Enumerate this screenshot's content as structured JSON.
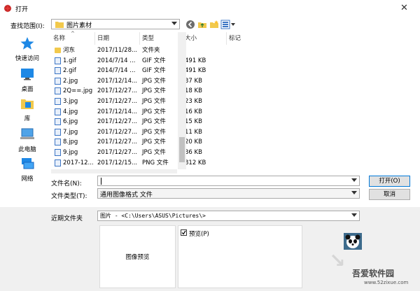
{
  "window": {
    "title": "打开"
  },
  "lookin": {
    "label": "查找范围(I):",
    "value": "图片素材"
  },
  "sidebar": {
    "items": [
      {
        "label": "快速访问",
        "icon": "star-icon"
      },
      {
        "label": "桌面",
        "icon": "desktop-icon"
      },
      {
        "label": "库",
        "icon": "library-icon"
      },
      {
        "label": "此电脑",
        "icon": "computer-icon"
      },
      {
        "label": "网络",
        "icon": "network-icon"
      }
    ]
  },
  "columns": [
    "名称",
    "日期",
    "类型",
    "大小",
    "标记"
  ],
  "files": [
    {
      "name": "河东",
      "date": "2017/11/28...",
      "type": "文件夹",
      "size": "",
      "icon": "folder-icon"
    },
    {
      "name": "1.gif",
      "date": "2014/7/14 ...",
      "type": "GIF 文件",
      "size": "491 KB",
      "icon": "file-icon"
    },
    {
      "name": "2.gif",
      "date": "2014/7/14 ...",
      "type": "GIF 文件",
      "size": "491 KB",
      "icon": "file-icon"
    },
    {
      "name": "2.jpg",
      "date": "2017/12/14...",
      "type": "JPG 文件",
      "size": "37 KB",
      "icon": "file-icon"
    },
    {
      "name": "2Q==.jpg",
      "date": "2017/12/27...",
      "type": "JPG 文件",
      "size": "18 KB",
      "icon": "file-icon"
    },
    {
      "name": "3.jpg",
      "date": "2017/12/27...",
      "type": "JPG 文件",
      "size": "23 KB",
      "icon": "file-icon"
    },
    {
      "name": "4.jpg",
      "date": "2017/12/14...",
      "type": "JPG 文件",
      "size": "16 KB",
      "icon": "file-icon"
    },
    {
      "name": "6.jpg",
      "date": "2017/12/27...",
      "type": "JPG 文件",
      "size": "15 KB",
      "icon": "file-icon"
    },
    {
      "name": "7.jpg",
      "date": "2017/12/27...",
      "type": "JPG 文件",
      "size": "11 KB",
      "icon": "file-icon"
    },
    {
      "name": "8.jpg",
      "date": "2017/12/27...",
      "type": "JPG 文件",
      "size": "20 KB",
      "icon": "file-icon"
    },
    {
      "name": "9.jpg",
      "date": "2017/12/27...",
      "type": "JPG 文件",
      "size": "36 KB",
      "icon": "file-icon"
    },
    {
      "name": "2017-12...",
      "date": "2017/12/15...",
      "type": "PNG 文件",
      "size": "812 KB",
      "icon": "file-icon"
    }
  ],
  "filename": {
    "label": "文件名(N):",
    "value": ""
  },
  "filetype": {
    "label": "文件类型(T):",
    "value": "通用图像格式 文件"
  },
  "buttons": {
    "open": "打开(O)",
    "cancel": "取消"
  },
  "recent": {
    "label": "近期文件夹",
    "value": "图片 - <C:\\Users\\ASUS\\Pictures\\>"
  },
  "preview": {
    "placeholder": "图像预览",
    "checkbox_label": "预览(P)",
    "checked": true
  },
  "watermark": {
    "text": "吾爱软件园",
    "url": "www.52zixue.com"
  }
}
